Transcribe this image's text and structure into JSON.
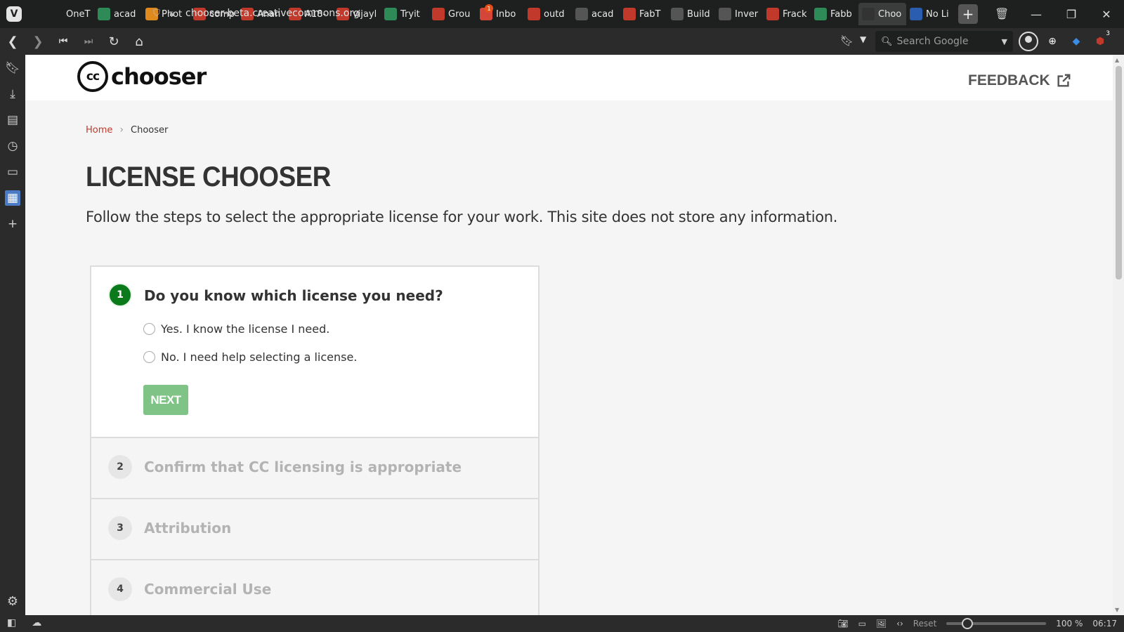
{
  "browser": {
    "tabs": [
      {
        "label": "OneT",
        "icon": "onetab-icon",
        "color": "#1e1f1f"
      },
      {
        "label": "acad",
        "icon": "grid-logo-icon",
        "color": "#2e8b57"
      },
      {
        "label": "Phot",
        "icon": "pinwheel-icon",
        "color": "#e08a1e"
      },
      {
        "label": "comp",
        "icon": "colored-square-icon",
        "color": "#c0392b"
      },
      {
        "label": "Anan",
        "icon": "colored-square-icon",
        "color": "#c0392b"
      },
      {
        "label": "A18-",
        "icon": "colored-square-icon",
        "color": "#c0392b"
      },
      {
        "label": "vijayl",
        "icon": "colored-square-icon",
        "color": "#c0392b"
      },
      {
        "label": "Tryit",
        "icon": "w3-icon",
        "color": "#2e8b57"
      },
      {
        "label": "Grou",
        "icon": "colored-square-icon",
        "color": "#c0392b"
      },
      {
        "label": "Inbo",
        "icon": "gmail-icon",
        "color": "#d44638",
        "badge": "1"
      },
      {
        "label": "outd",
        "icon": "colored-square-icon",
        "color": "#c0392b"
      },
      {
        "label": "acad",
        "icon": "document-icon",
        "color": "#555"
      },
      {
        "label": "FabT",
        "icon": "colored-square-icon",
        "color": "#c0392b"
      },
      {
        "label": "Build",
        "icon": "document-icon",
        "color": "#555"
      },
      {
        "label": "Inver",
        "icon": "book-icon",
        "color": "#555"
      },
      {
        "label": "Frack",
        "icon": "pen-icon",
        "color": "#c0392b"
      },
      {
        "label": "Fabb",
        "icon": "gear-green-icon",
        "color": "#2e8b57"
      },
      {
        "label": "Choo",
        "icon": "cc-icon",
        "color": "#333",
        "active": true
      },
      {
        "label": "No Li",
        "icon": "question-icon",
        "color": "#2a5db0"
      }
    ],
    "url": "chooser-beta.creativecommons.org",
    "search_placeholder": "Search Google",
    "ext_badge": "3",
    "status": {
      "reset_label": "Reset",
      "zoom": "100 %",
      "time": "06:17"
    }
  },
  "site": {
    "logo_mark": "cc",
    "logo_word": "chooser",
    "feedback_label": "FEEDBACK"
  },
  "breadcrumb": {
    "home": "Home",
    "separator": "›",
    "current": "Chooser"
  },
  "page": {
    "title": "LICENSE CHOOSER",
    "intro": "Follow the steps to select the appropriate license for your work. This site does not store any information."
  },
  "stepper": {
    "active_step": {
      "number": "1",
      "title": "Do you know which license you need?",
      "options": [
        "Yes. I know the license I need.",
        "No. I need help selecting a license."
      ],
      "next_label": "NEXT"
    },
    "steps": [
      {
        "number": "2",
        "title": "Confirm that CC licensing is appropriate"
      },
      {
        "number": "3",
        "title": "Attribution"
      },
      {
        "number": "4",
        "title": "Commercial Use"
      }
    ]
  }
}
